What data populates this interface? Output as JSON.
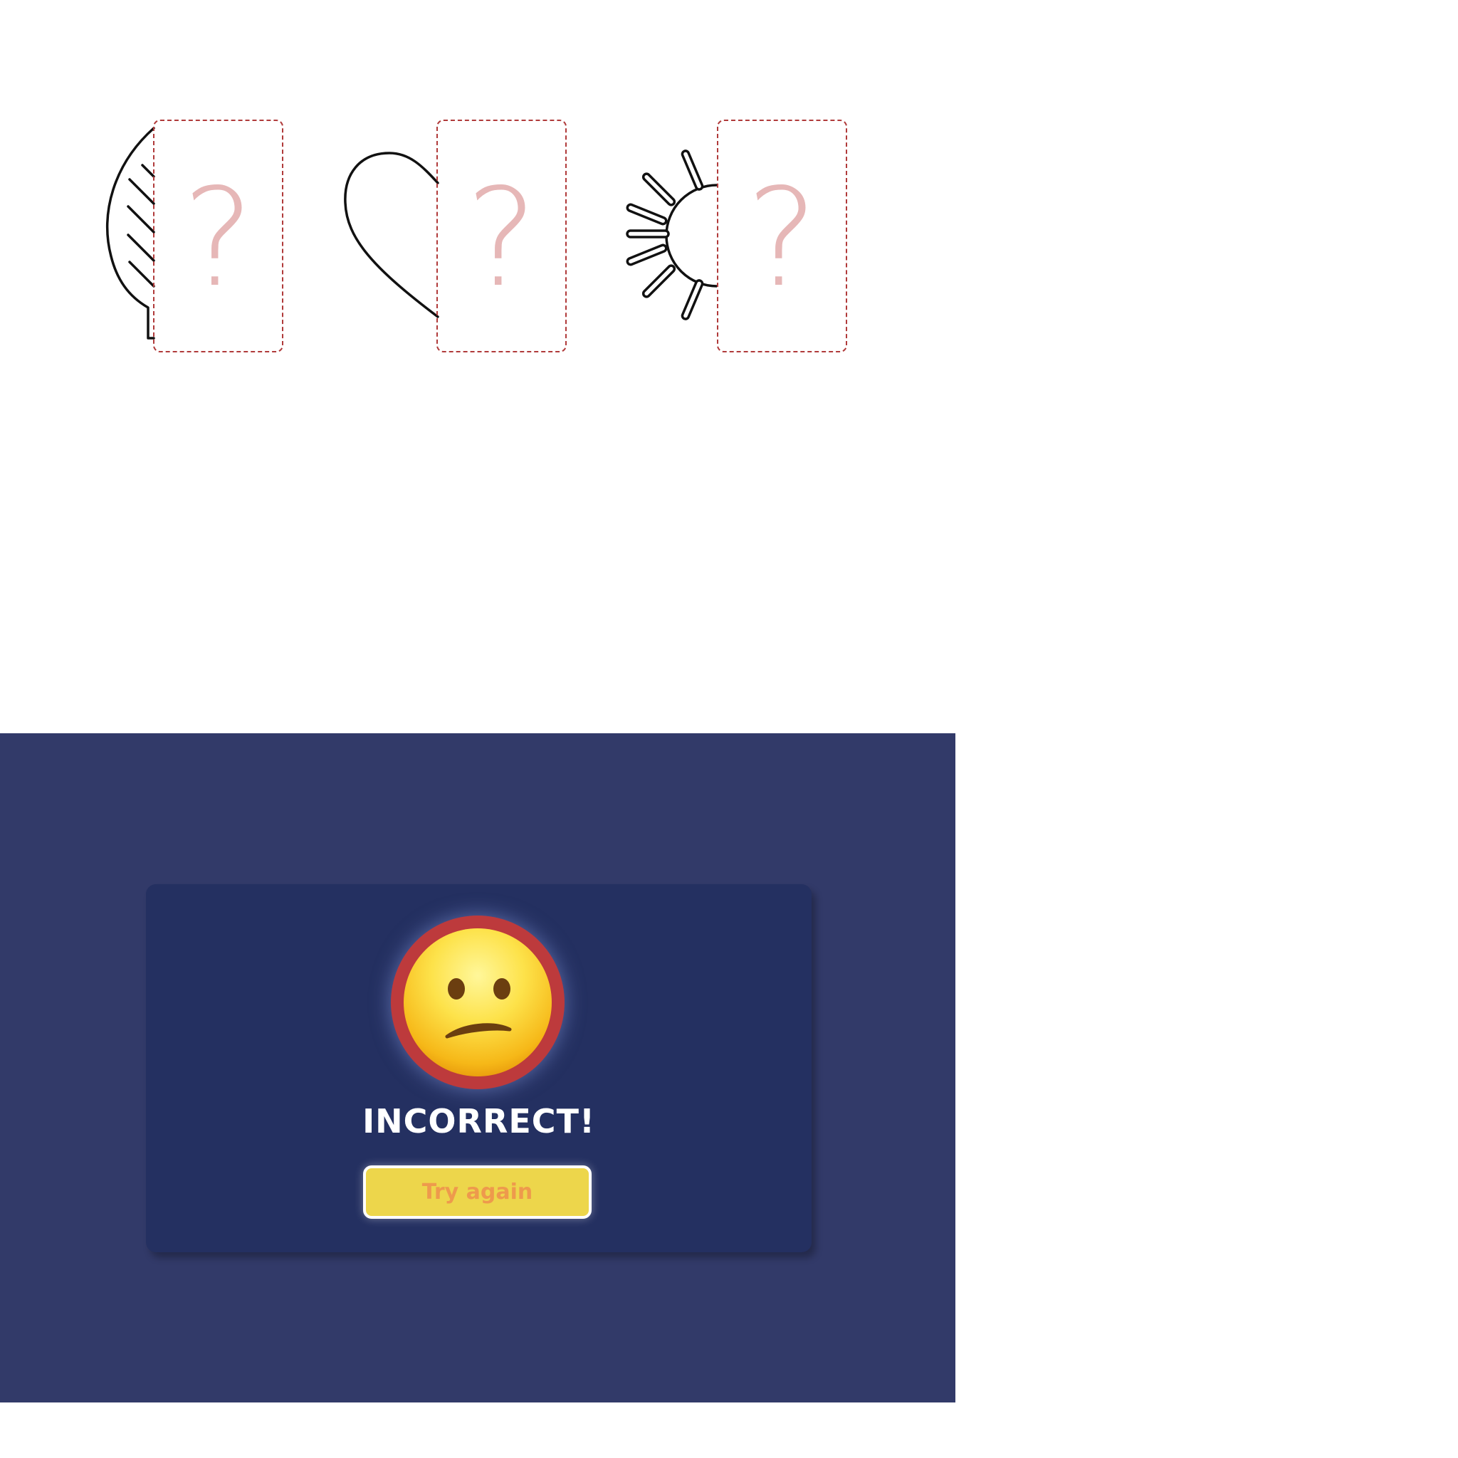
{
  "puzzle": {
    "items": [
      {
        "shape_icon": "leaf-half-icon",
        "slot_label": "?"
      },
      {
        "shape_icon": "heart-half-icon",
        "slot_label": "?"
      },
      {
        "shape_icon": "sun-half-icon",
        "slot_label": "?"
      }
    ]
  },
  "result": {
    "emoji_icon": "confused-face-icon",
    "title": "INCORRECT!",
    "button_label": "Try again"
  },
  "colors": {
    "slot_border": "#b03a3a",
    "question_mark": "#e6b7b7",
    "overlay": "#323a69",
    "dialog": "#243061",
    "ring": "#bd3a3c",
    "button": "#edd64b",
    "button_text": "#ee9a4c"
  }
}
